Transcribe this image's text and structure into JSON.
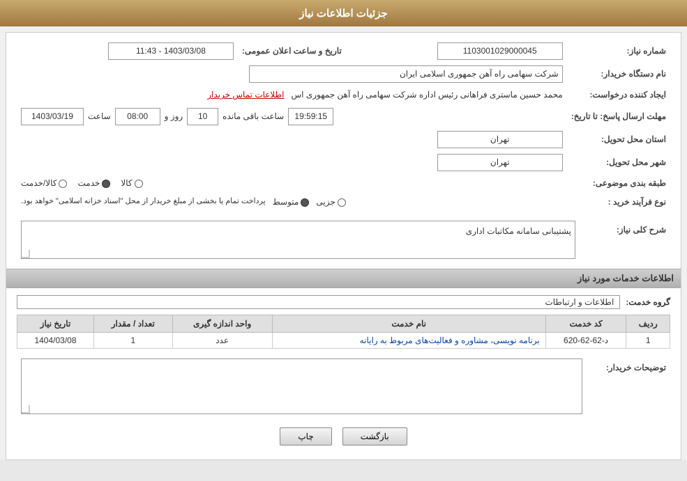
{
  "header": {
    "title": "جزئیات اطلاعات نیاز"
  },
  "fields": {
    "need_number_label": "شماره نیاز:",
    "need_number_value": "1103001029000045",
    "buyer_org_label": "نام دستگاه خریدار:",
    "buyer_org_value": "شرکت سهامی راه آهن جمهوری اسلامی ایران",
    "creator_label": "ایجاد کننده درخواست:",
    "creator_value": "محمد حسین ماستری فراهانی رئیس اداره شرکت سهامی راه آهن جمهوری اس",
    "creator_link": "اطلاعات تماس خریدار",
    "deadline_label": "مهلت ارسال پاسخ: تا تاریخ:",
    "deadline_date": "1403/03/19",
    "deadline_time_label": "ساعت",
    "deadline_time": "08:00",
    "deadline_day_label": "روز و",
    "deadline_days": "10",
    "deadline_remaining_label": "ساعت باقی مانده",
    "deadline_remaining_time": "19:59:15",
    "announce_date_label": "تاریخ و ساعت اعلان عمومی:",
    "announce_date_value": "1403/03/08 - 11:43",
    "province_label": "استان محل تحویل:",
    "province_value": "تهران",
    "city_label": "شهر محل تحویل:",
    "city_value": "تهران",
    "category_label": "طبقه بندی موضوعی:",
    "category_options": [
      {
        "label": "کالا",
        "selected": false
      },
      {
        "label": "خدمت",
        "selected": true
      },
      {
        "label": "کالا/خدمت",
        "selected": false
      }
    ],
    "purchase_type_label": "نوع فرآیند خرید :",
    "purchase_type_options": [
      {
        "label": "جزیی",
        "selected": false
      },
      {
        "label": "متوسط",
        "selected": true
      }
    ],
    "purchase_type_desc": "پرداخت تمام یا بخشی از مبلغ خریدار از محل \"اسناد خزانه اسلامی\" خواهد بود.",
    "need_desc_label": "شرح کلی نیاز:",
    "need_desc_value": "پشتیبانی سامانه مکاتبات اداری",
    "services_section_title": "اطلاعات خدمات مورد نیاز",
    "service_group_label": "گروه خدمت:",
    "service_group_value": "اطلاعات و ارتباطات",
    "table_headers": [
      "ردیف",
      "کد خدمت",
      "نام خدمت",
      "واحد اندازه گیری",
      "تعداد / مقدار",
      "تاریخ نیاز"
    ],
    "table_rows": [
      {
        "row_num": "1",
        "service_code": "د-62-62-620",
        "service_name": "برنامه نویسی، مشاوره و فعالیت‌های مربوط به رایانه",
        "unit": "عدد",
        "quantity": "1",
        "date": "1404/03/08"
      }
    ],
    "buyer_desc_label": "توضیحات خریدار:",
    "btn_print": "چاپ",
    "btn_back": "بازگشت"
  }
}
